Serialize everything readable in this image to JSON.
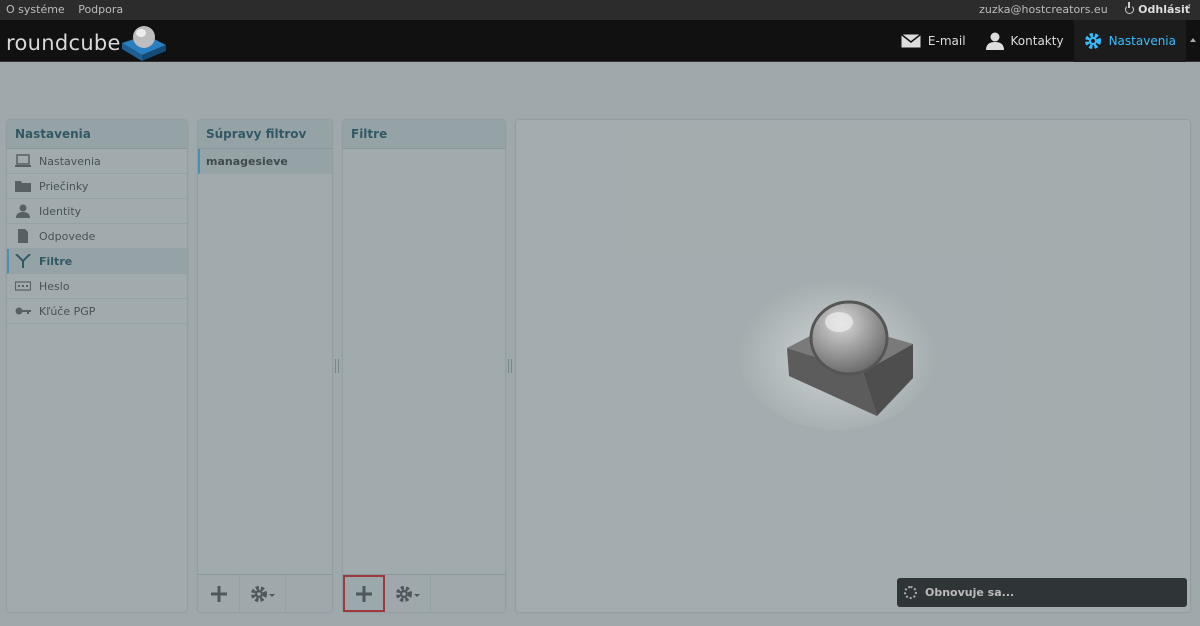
{
  "topbar": {
    "about": "O systéme",
    "support": "Podpora",
    "user_email": "zuzka@hostcreators.eu",
    "logout": "Odhlásiť"
  },
  "header": {
    "logo_text": "roundcube",
    "nav": [
      {
        "label": "E-mail",
        "icon": "envelope-icon"
      },
      {
        "label": "Kontakty",
        "icon": "person-icon"
      },
      {
        "label": "Nastavenia",
        "icon": "gear-icon",
        "active": true
      }
    ]
  },
  "settings_panel": {
    "title": "Nastavenia",
    "items": [
      {
        "label": "Nastavenia",
        "icon": "laptop-icon"
      },
      {
        "label": "Priečinky",
        "icon": "folder-icon"
      },
      {
        "label": "Identity",
        "icon": "person-icon"
      },
      {
        "label": "Odpovede",
        "icon": "document-icon"
      },
      {
        "label": "Filtre",
        "icon": "filter-icon",
        "selected": true
      },
      {
        "label": "Heslo",
        "icon": "password-icon"
      },
      {
        "label": "Kľúče PGP",
        "icon": "key-icon"
      }
    ]
  },
  "filtersets_panel": {
    "title": "Súpravy filtrov",
    "items": [
      "managesieve"
    ]
  },
  "filters_panel": {
    "title": "Filtre"
  },
  "status": {
    "text": "Obnovuje sa..."
  },
  "colors": {
    "accent": "#37beff",
    "header_bg": "#111111",
    "panel_head": "#dfe9ec",
    "highlight": "#e00000"
  }
}
